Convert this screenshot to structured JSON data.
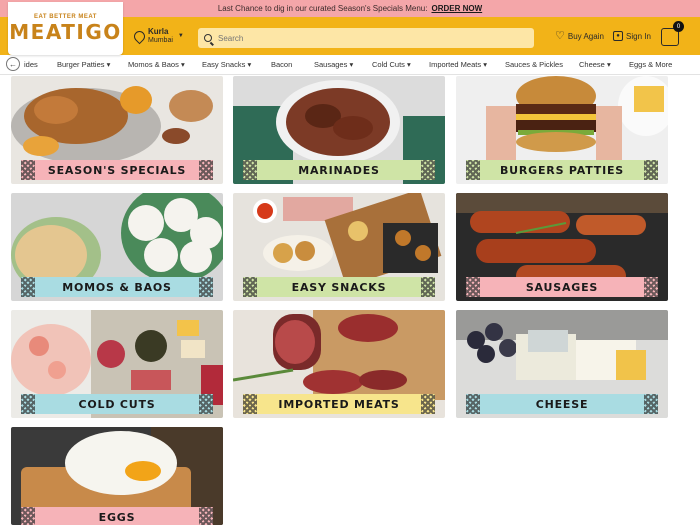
{
  "promo": {
    "text": "Last Chance to dig in our curated Season's Specials Menu:",
    "link": "ORDER NOW"
  },
  "brand": {
    "tagline": "EAT BETTER MEAT",
    "name": "MEATIGO"
  },
  "location": {
    "city": "Kurla",
    "region": "Mumbai"
  },
  "search": {
    "placeholder": "Search"
  },
  "actions": {
    "buy_again": "Buy Again",
    "sign_in": "Sign In",
    "cart_count": "0"
  },
  "nav": {
    "items": [
      {
        "label": "ides",
        "caret": ""
      },
      {
        "label": "Burger Patties",
        "caret": "▾"
      },
      {
        "label": "Momos & Baos",
        "caret": "▾"
      },
      {
        "label": "Easy Snacks",
        "caret": "▾"
      },
      {
        "label": "Bacon",
        "caret": ""
      },
      {
        "label": "Sausages",
        "caret": "▾"
      },
      {
        "label": "Cold Cuts",
        "caret": "▾"
      },
      {
        "label": "Imported Meats",
        "caret": "▾"
      },
      {
        "label": "Sauces & Pickles",
        "caret": ""
      },
      {
        "label": "Cheese",
        "caret": "▾"
      },
      {
        "label": "Eggs & More",
        "caret": ""
      }
    ]
  },
  "categories": [
    {
      "label": "SEASON'S SPECIALS",
      "color": "#f6b3b8"
    },
    {
      "label": "MARINADES",
      "color": "#cfe4a6"
    },
    {
      "label": "BURGERS PATTIES",
      "color": "#cfe4a6"
    },
    {
      "label": "MOMOS & BAOS",
      "color": "#a9dce2"
    },
    {
      "label": "EASY SNACKS",
      "color": "#cfe4a6"
    },
    {
      "label": "SAUSAGES",
      "color": "#f6b3b8"
    },
    {
      "label": "COLD CUTS",
      "color": "#a9dce2"
    },
    {
      "label": "IMPORTED MEATS",
      "color": "#f7e58c"
    },
    {
      "label": "CHEESE",
      "color": "#a9dce2"
    },
    {
      "label": "EGGS",
      "color": "#f6b3b8"
    }
  ]
}
